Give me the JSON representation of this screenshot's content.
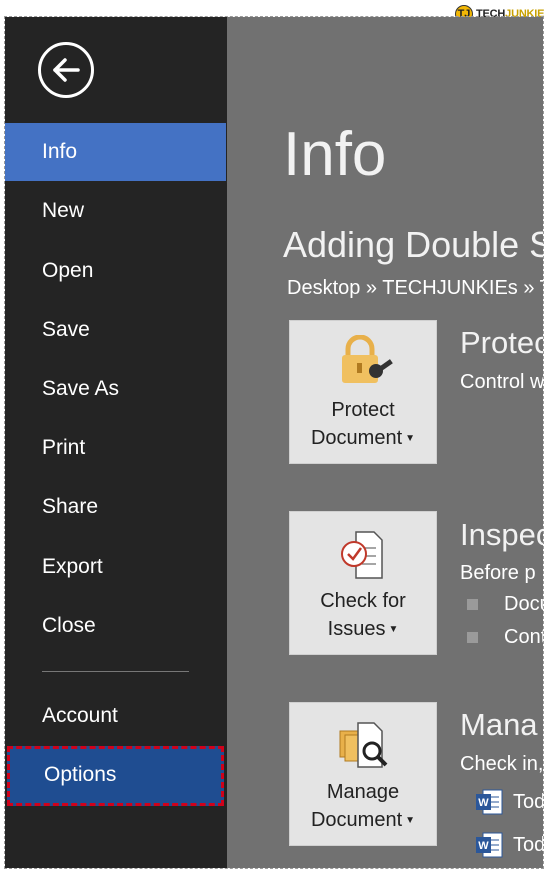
{
  "watermark": {
    "prefix": "TECH",
    "suffix": "JUNKIE",
    "logo": "TJ"
  },
  "sidebar": {
    "items": [
      {
        "label": "Info"
      },
      {
        "label": "New"
      },
      {
        "label": "Open"
      },
      {
        "label": "Save"
      },
      {
        "label": "Save As"
      },
      {
        "label": "Print"
      },
      {
        "label": "Share"
      },
      {
        "label": "Export"
      },
      {
        "label": "Close"
      },
      {
        "label": "Account"
      },
      {
        "label": "Options"
      }
    ]
  },
  "main": {
    "title": "Info",
    "document_title": "Adding Double S",
    "breadcrumb": "Desktop » TECHJUNKIEs » T",
    "protect": {
      "tile_line1": "Protect",
      "tile_line2": "Document",
      "heading": "Protec",
      "desc": "Control w"
    },
    "inspect": {
      "tile_line1": "Check for",
      "tile_line2": "Issues",
      "heading": "Inspec",
      "desc": "Before p",
      "bullets": [
        "Docu",
        "Cont"
      ]
    },
    "manage": {
      "tile_line1": "Manage",
      "tile_line2": "Document",
      "heading": "Mana",
      "desc": "Check in,",
      "files": [
        "Tod",
        "Tod"
      ]
    }
  },
  "colors": {
    "sidebar_bg": "#242424",
    "active_item": "#4472c4",
    "options_highlight": "#1f4d91",
    "main_bg": "#717171",
    "annotation_border": "#d0021b"
  }
}
